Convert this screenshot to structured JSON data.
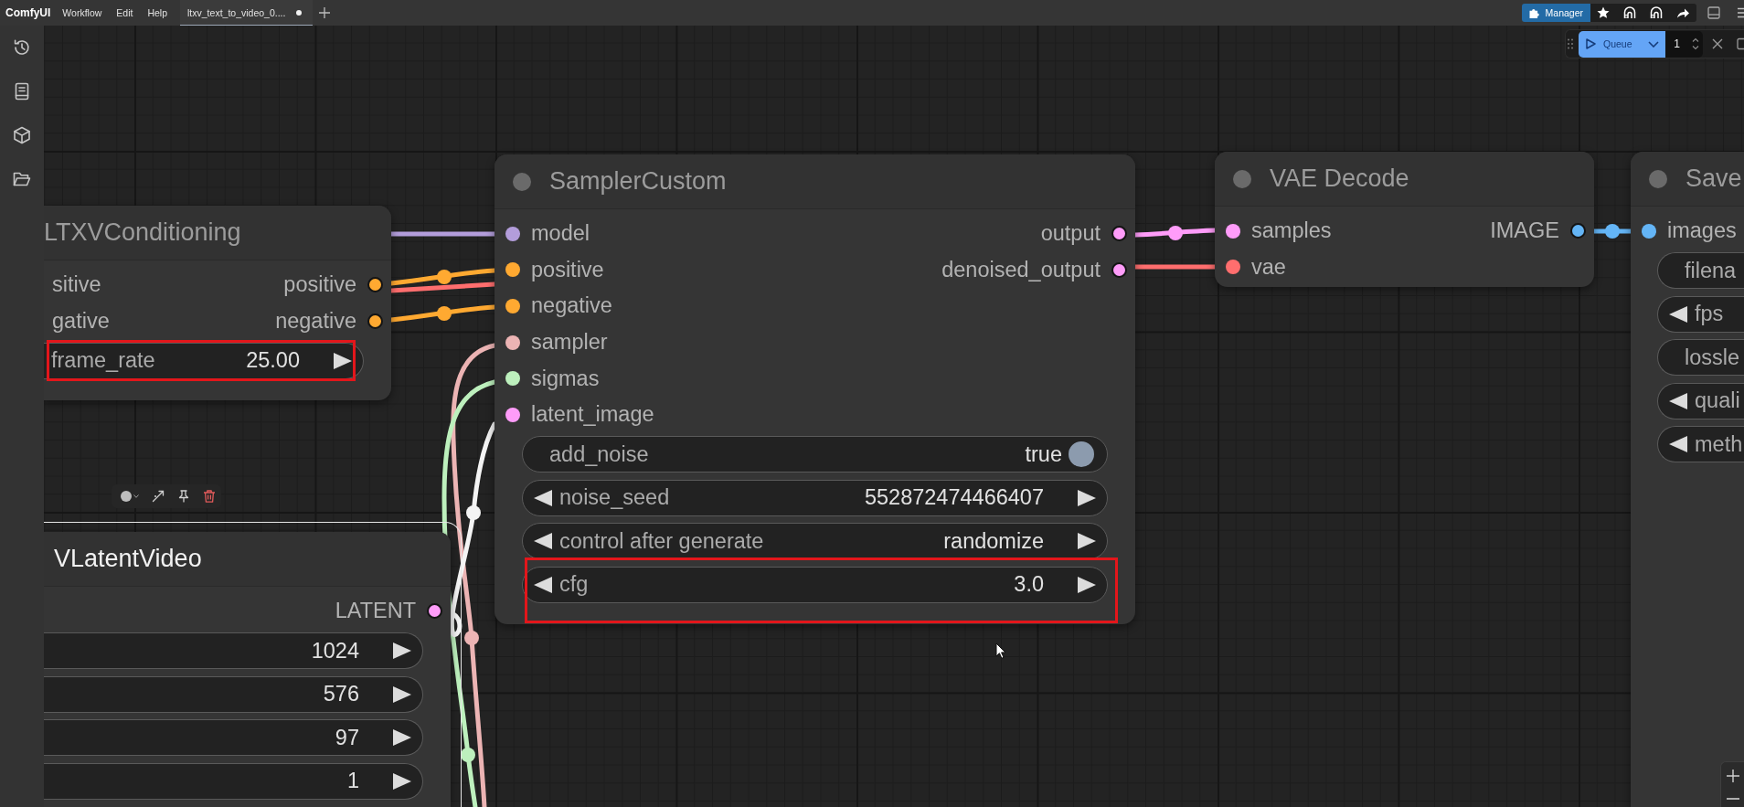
{
  "menu_bar": {
    "logo": "ComfyUI",
    "menus": [
      "Workflow",
      "Edit",
      "Help"
    ],
    "tabs": [
      {
        "label": "ltxv_text_to_video_0....",
        "selected": true,
        "unsaved": true
      }
    ],
    "manager_button": "Manager"
  },
  "queue_bar": {
    "button": "Queue",
    "count": "1"
  },
  "nodes": [
    {
      "title": "LTXVConditioning",
      "selected": false,
      "inputs": [
        {
          "label": "sitive"
        },
        {
          "label": "gative"
        }
      ],
      "outputs": [
        {
          "label": "positive",
          "color": "#ffa931"
        },
        {
          "label": "negative",
          "color": "#ffa931"
        }
      ],
      "widgets": [
        {
          "kind": "number",
          "label": "frame_rate",
          "value": "25.00",
          "highlighted": true
        }
      ]
    },
    {
      "title": "VLatentVideo",
      "selected": true,
      "outputs": [
        {
          "label": "LATENT",
          "color": "#ff9cf9"
        }
      ],
      "widgets": [
        {
          "kind": "number",
          "value": "1024",
          "highlighted": false
        },
        {
          "kind": "number",
          "value": "576",
          "highlighted": false
        },
        {
          "kind": "number",
          "value": "97",
          "highlighted": false
        },
        {
          "kind": "number",
          "value": "1",
          "highlighted": false
        }
      ]
    },
    {
      "title": "SamplerCustom",
      "selected": false,
      "inputs": [
        {
          "label": "model",
          "color": "#b39ddb"
        },
        {
          "label": "positive",
          "color": "#ffa931"
        },
        {
          "label": "negative",
          "color": "#ffa931"
        },
        {
          "label": "sampler",
          "color": "#ecb4b4"
        },
        {
          "label": "sigmas",
          "color": "#bdf0bd"
        },
        {
          "label": "latent_image",
          "color": "#ff9cf9"
        }
      ],
      "outputs": [
        {
          "label": "output",
          "color": "#ff9cf9"
        },
        {
          "label": "denoised_output",
          "color": "#ff9cf9"
        }
      ],
      "widgets": [
        {
          "kind": "toggle",
          "label": "add_noise",
          "value": "true",
          "on": true,
          "highlighted": false
        },
        {
          "kind": "number",
          "label": "noise_seed",
          "value": "552872474466407",
          "highlighted": false
        },
        {
          "kind": "combo",
          "label": "control after generate",
          "value": "randomize",
          "highlighted": false
        },
        {
          "kind": "number",
          "label": "cfg",
          "value": "3.0",
          "highlighted": true
        }
      ]
    },
    {
      "title": "VAE Decode",
      "selected": false,
      "inputs": [
        {
          "label": "samples",
          "color": "#ff9cf9"
        },
        {
          "label": "vae",
          "color": "#ff6e6e"
        }
      ],
      "outputs": [
        {
          "label": "IMAGE",
          "color": "#64b5f6"
        }
      ]
    },
    {
      "title": "Save",
      "selected": false,
      "inputs": [
        {
          "label": "images",
          "color": "#64b5f6"
        }
      ],
      "widgets": [
        {
          "kind": "text",
          "label": "filena",
          "highlighted": false
        },
        {
          "kind": "number",
          "label": "fps",
          "highlighted": false
        },
        {
          "kind": "toggle",
          "label": "lossle",
          "highlighted": false
        },
        {
          "kind": "number",
          "label": "quali",
          "highlighted": false
        },
        {
          "kind": "combo",
          "label": "meth",
          "highlighted": false
        }
      ]
    }
  ]
}
